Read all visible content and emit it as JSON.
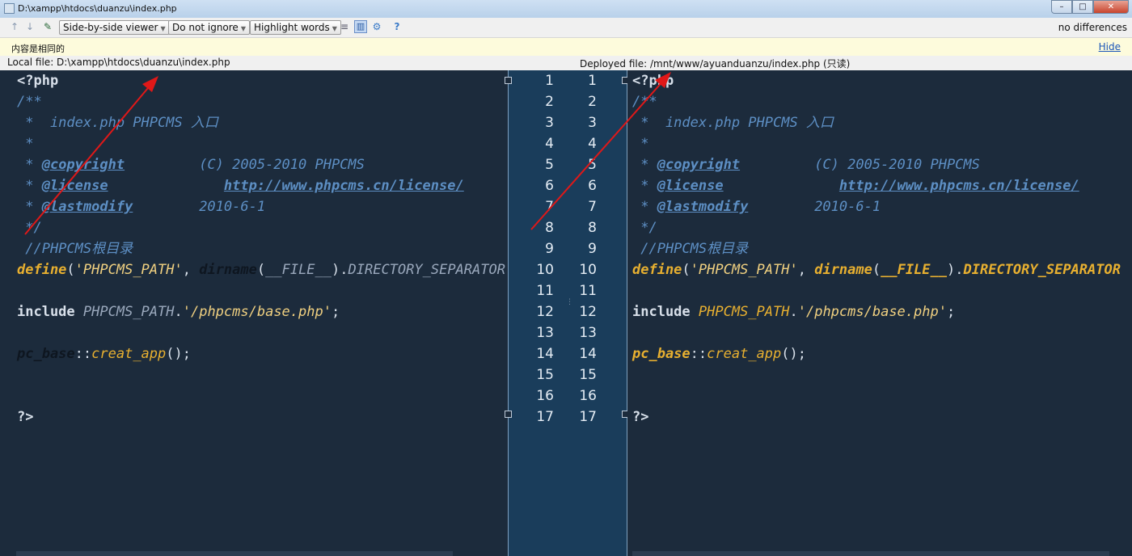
{
  "window": {
    "title": "D:\\xampp\\htdocs\\duanzu\\index.php",
    "buttons": {
      "minimize": "–",
      "maximize": "□",
      "close": "✕"
    }
  },
  "toolbar": {
    "viewer": "Side-by-side viewer",
    "ignore": "Do not ignore",
    "highlight": "Highlight words",
    "help": "?",
    "status": "no differences",
    "icons": [
      "arrow-up-icon",
      "arrow-down-icon",
      "jump-to-source-icon",
      "collapse-icon",
      "side-by-side-icon",
      "settings-icon",
      "help-icon"
    ]
  },
  "notice": {
    "message": "内容是相同的",
    "hide": "Hide"
  },
  "files": {
    "local": "Local file: D:\\xampp\\htdocs\\duanzu\\index.php",
    "deployed": "Deployed file: /mnt/www/ayuanduanzu/index.php (只读)"
  },
  "code": {
    "l1": "<?php",
    "l2": "/**",
    "l3": " *  index.php PHPCMS 入口",
    "l4": " *",
    "l5a": " * ",
    "l5b": "@copyright",
    "l5c": "         (C) 2005-2010 PHPCMS",
    "l6a": " * ",
    "l6b": "@license",
    "l6c": "              ",
    "l6d": "http://www.phpcms.cn/license/",
    "l7a": " * ",
    "l7b": "@lastmodify",
    "l7c": "        2010-6-1",
    "l8": " */",
    "l9": " //PHPCMS根目录",
    "l10a": "define",
    "l10b": "(",
    "l10c": "'PHPCMS_PATH'",
    "l10d": ", ",
    "l10e": "dirname",
    "l10f": "(",
    "l10g": "__FILE__",
    "l10h": ").",
    "l10i": "DIRECTORY_SEPARATOR",
    "l12a": "include ",
    "l12b": "PHPCMS_PATH",
    "l12c": ".",
    "l12d": "'/phpcms/base.php'",
    "l12e": ";",
    "l14a": "pc_base",
    "l14b": "::",
    "l14c": "creat_app",
    "l14d": "();",
    "l17": "?>"
  },
  "line_numbers": [
    "1",
    "2",
    "3",
    "4",
    "5",
    "6",
    "7",
    "8",
    "9",
    "10",
    "11",
    "12",
    "13",
    "14",
    "15",
    "16",
    "17"
  ]
}
